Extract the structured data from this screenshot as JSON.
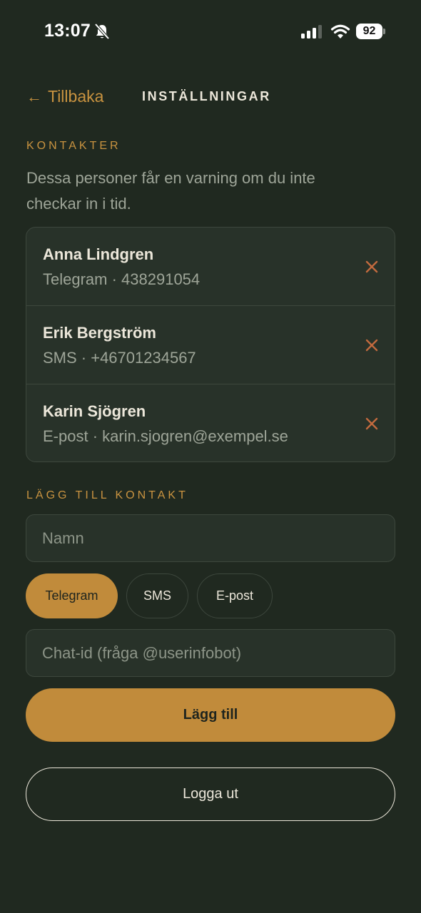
{
  "status_bar": {
    "time": "13:07",
    "battery": "92",
    "icons": [
      "bell-slash-icon",
      "signal-icon",
      "wifi-icon",
      "battery-icon"
    ]
  },
  "header": {
    "back_arrow": "←",
    "back_label": "Tillbaka",
    "title": "INSTÄLLNINGAR"
  },
  "contacts_section": {
    "label": "KONTAKTER",
    "description": "Dessa personer får en varning om du inte checkar in i tid.",
    "contacts": [
      {
        "name": "Anna Lindgren",
        "detail": "Telegram · 438291054"
      },
      {
        "name": "Erik Bergström",
        "detail": "SMS · +46701234567"
      },
      {
        "name": "Karin Sjögren",
        "detail": "E-post · karin.sjogren@exempel.se"
      }
    ],
    "remove_icon": "close-icon"
  },
  "add_section": {
    "label": "LÄGG TILL KONTAKT",
    "name_placeholder": "Namn",
    "channels": [
      "Telegram",
      "SMS",
      "E-post"
    ],
    "selected_channel": "Telegram",
    "chat_id_placeholder": "Chat-id (fråga @userinfobot)",
    "add_label": "Lägg till"
  },
  "logout_label": "Logga ut",
  "colors": {
    "background": "#202920",
    "card": "#283229",
    "accent": "#c18b3b",
    "remove": "#c26a3e",
    "text_primary": "#ece7da",
    "text_muted": "#9ea598"
  }
}
